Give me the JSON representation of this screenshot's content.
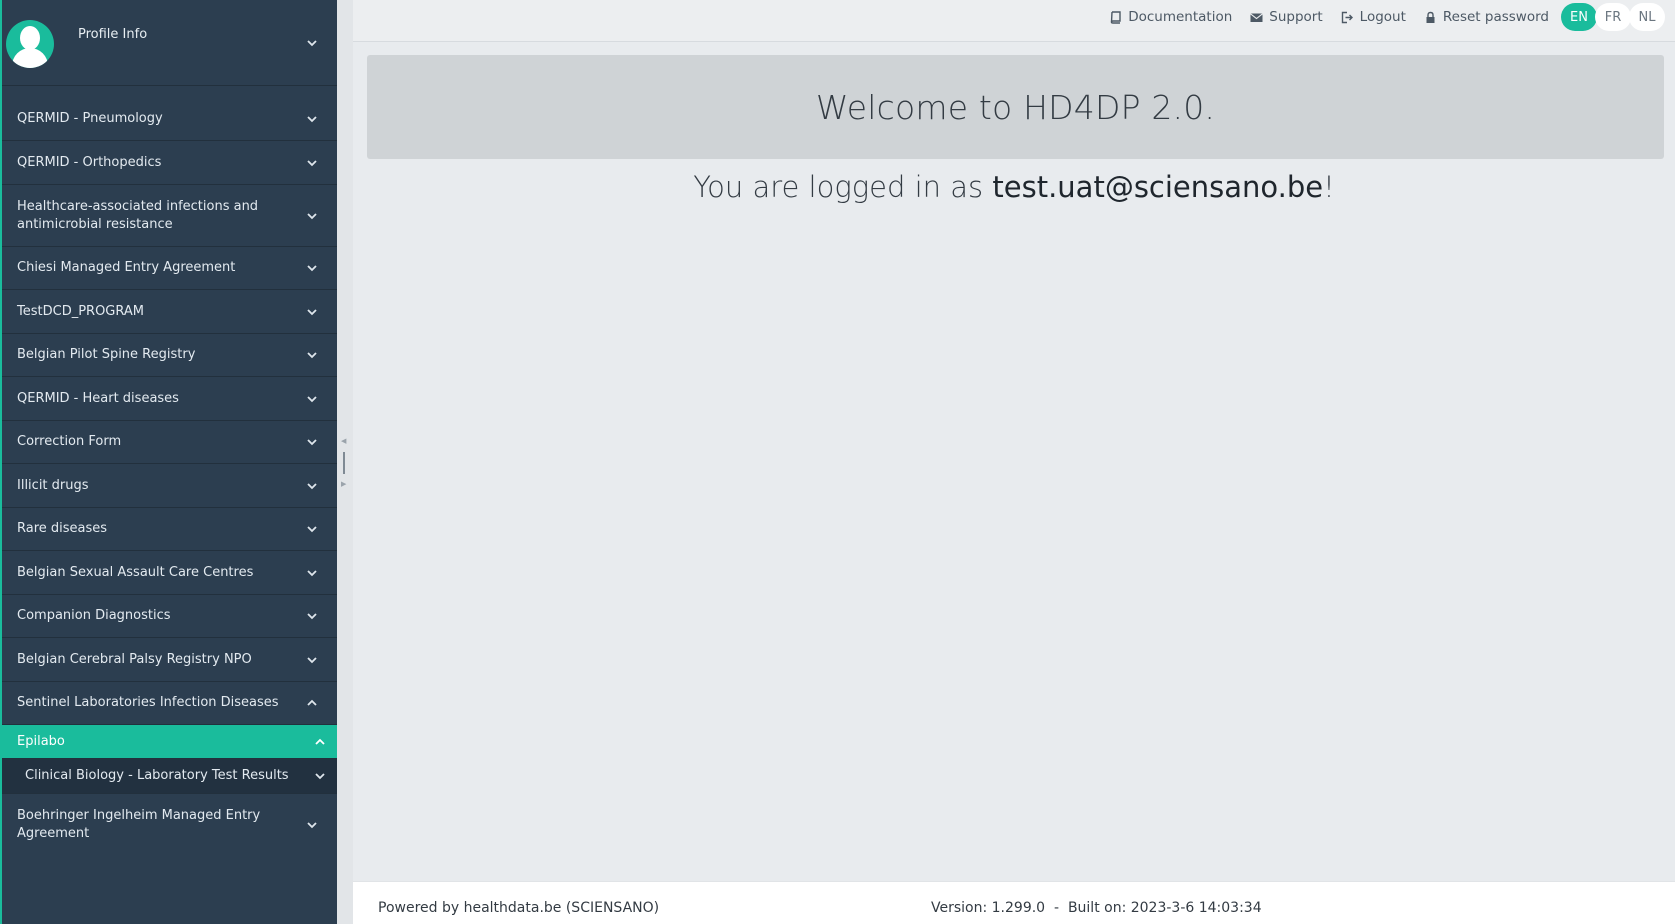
{
  "sidebar": {
    "profile_label": "Profile Info",
    "items": [
      {
        "label": "QERMID - Pneumology"
      },
      {
        "label": "QERMID - Orthopedics"
      },
      {
        "label": "Healthcare-associated infections and antimicrobial resistance"
      },
      {
        "label": "Chiesi Managed Entry Agreement"
      },
      {
        "label": "TestDCD_PROGRAM"
      },
      {
        "label": "Belgian Pilot Spine Registry"
      },
      {
        "label": "QERMID - Heart diseases"
      },
      {
        "label": "Correction Form"
      },
      {
        "label": "Illicit drugs"
      },
      {
        "label": "Rare diseases"
      },
      {
        "label": "Belgian Sexual Assault Care Centres"
      },
      {
        "label": "Companion Diagnostics"
      },
      {
        "label": "Belgian Cerebral Palsy Registry NPO"
      },
      {
        "label": "Sentinel Laboratories Infection Diseases"
      },
      {
        "label": "Epilabo"
      },
      {
        "label": "Clinical Biology - Laboratory Test Results"
      },
      {
        "label": "Boehringer Ingelheim Managed Entry Agreement"
      }
    ]
  },
  "topbar": {
    "documentation": "Documentation",
    "support": "Support",
    "logout": "Logout",
    "reset_password": "Reset password",
    "languages": [
      "EN",
      "FR",
      "NL"
    ],
    "active_language": "EN"
  },
  "main": {
    "welcome": "Welcome to HD4DP 2.0.",
    "logged_prefix": "You are logged in as ",
    "user": "test.uat@sciensano.be",
    "logged_suffix": "!"
  },
  "footer": {
    "powered": "Powered by healthdata.be (SCIENSANO)",
    "version": "Version: 1.299.0  -  Built on: 2023-3-6 14:03:34"
  },
  "colors": {
    "sidebar_bg": "#2c3e50",
    "accent": "#1abc9c",
    "content_bg": "#e8ebee"
  }
}
